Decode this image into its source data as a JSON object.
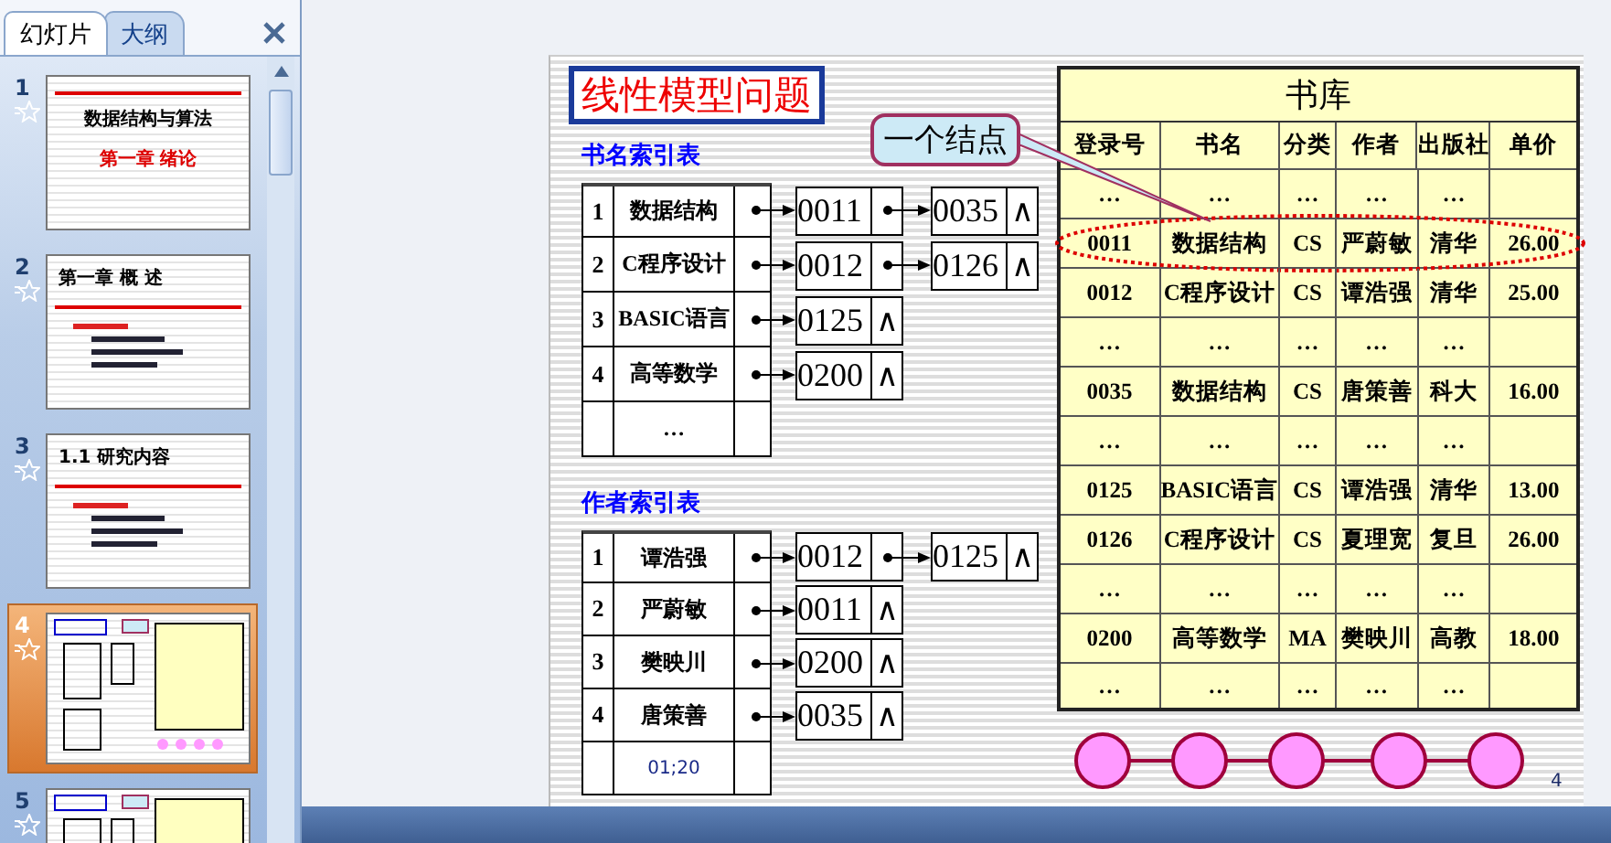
{
  "panel": {
    "tabs": [
      {
        "label": "幻灯片",
        "selected": true
      },
      {
        "label": "大纲",
        "selected": false
      }
    ],
    "thumbnails": [
      {
        "number": "1",
        "kind": "title",
        "title": "数据结构与算法",
        "subtitle": "第一章 绪论",
        "selected": false
      },
      {
        "number": "2",
        "kind": "list",
        "title": "第一章 概 述",
        "selected": false
      },
      {
        "number": "3",
        "kind": "list",
        "title": "1.1 研究内容",
        "selected": false
      },
      {
        "number": "4",
        "kind": "diagram",
        "selected": true
      },
      {
        "number": "5",
        "kind": "diagram",
        "selected": false
      }
    ]
  },
  "slide": {
    "title": "线性模型问题",
    "callout": "一个结点",
    "book_index": {
      "heading": "书名索引表",
      "rows": [
        {
          "number": "1",
          "name": "数据结构",
          "nodes": [
            {
              "value": "0011"
            },
            {
              "value": "0035",
              "terminator": "∧"
            }
          ]
        },
        {
          "number": "2",
          "name": "C程序设计",
          "nodes": [
            {
              "value": "0012"
            },
            {
              "value": "0126",
              "terminator": "∧"
            }
          ]
        },
        {
          "number": "3",
          "name": "BASIC语言",
          "nodes": [
            {
              "value": "0125",
              "terminator": "∧"
            }
          ]
        },
        {
          "number": "4",
          "name": "高等数学",
          "nodes": [
            {
              "value": "0200",
              "terminator": "∧"
            }
          ]
        },
        {
          "name": "…",
          "nodes": []
        }
      ]
    },
    "author_index": {
      "heading": "作者索引表",
      "rows": [
        {
          "number": "1",
          "name": "谭浩强",
          "nodes": [
            {
              "value": "0012"
            },
            {
              "value": "0125",
              "terminator": "∧"
            }
          ]
        },
        {
          "number": "2",
          "name": "严蔚敏",
          "nodes": [
            {
              "value": "0011",
              "terminator": "∧"
            }
          ]
        },
        {
          "number": "3",
          "name": "樊映川",
          "nodes": [
            {
              "value": "0200",
              "terminator": "∧"
            }
          ]
        },
        {
          "number": "4",
          "name": "唐策善",
          "nodes": [
            {
              "value": "0035",
              "terminator": "∧"
            }
          ]
        },
        {
          "name": "01;20",
          "kind": "note",
          "nodes": []
        }
      ]
    },
    "library": {
      "title": "书库",
      "columns": [
        "登录号",
        "书名",
        "分类",
        "作者",
        "出版社",
        "单价"
      ],
      "rows": [
        {
          "cells": [
            "…",
            "…",
            "…",
            "…",
            "…"
          ],
          "circled": false
        },
        {
          "cells": [
            "0011",
            "数据结构",
            "CS",
            "严蔚敏",
            "清华",
            "26.00"
          ],
          "circled": true
        },
        {
          "cells": [
            "0012",
            "C程序设计",
            "CS",
            "谭浩强",
            "清华",
            "25.00"
          ],
          "circled": false
        },
        {
          "cells": [
            "…",
            "…",
            "…",
            "…",
            "…"
          ],
          "circled": false
        },
        {
          "cells": [
            "0035",
            "数据结构",
            "CS",
            "唐策善",
            "科大",
            "16.00"
          ],
          "circled": false
        },
        {
          "cells": [
            "…",
            "…",
            "…",
            "…",
            "…"
          ],
          "circled": false
        },
        {
          "cells": [
            "0125",
            "BASIC语言",
            "CS",
            "谭浩强",
            "清华",
            "13.00"
          ],
          "circled": false
        },
        {
          "cells": [
            "0126",
            "C程序设计",
            "CS",
            "夏理宽",
            "复旦",
            "26.00"
          ],
          "circled": false
        },
        {
          "cells": [
            "…",
            "…",
            "…",
            "…",
            "…"
          ],
          "circled": false
        },
        {
          "cells": [
            "0200",
            "高等数学",
            "MA",
            "樊映川",
            "高教",
            "18.00"
          ],
          "circled": false
        },
        {
          "cells": [
            "…",
            "…",
            "…",
            "…",
            "…"
          ],
          "circled": false
        }
      ]
    },
    "page_number": "4"
  }
}
